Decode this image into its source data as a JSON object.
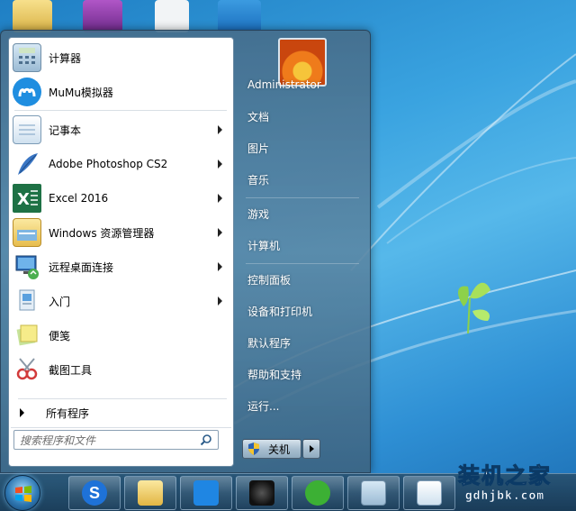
{
  "start_menu": {
    "programs": [
      {
        "label": "计算器",
        "icon": "calculator-icon",
        "has_submenu": false
      },
      {
        "label": "MuMu模拟器",
        "icon": "mumu-emulator-icon",
        "has_submenu": false
      },
      {
        "label": "记事本",
        "icon": "notepad-icon",
        "has_submenu": true
      },
      {
        "label": "Adobe Photoshop CS2",
        "icon": "photoshop-feather-icon",
        "has_submenu": true
      },
      {
        "label": "Excel 2016",
        "icon": "excel-icon",
        "has_submenu": true
      },
      {
        "label": "Windows 资源管理器",
        "icon": "explorer-folder-icon",
        "has_submenu": true
      },
      {
        "label": "远程桌面连接",
        "icon": "remote-desktop-icon",
        "has_submenu": true
      },
      {
        "label": "入门",
        "icon": "getting-started-icon",
        "has_submenu": true
      },
      {
        "label": "便笺",
        "icon": "sticky-notes-icon",
        "has_submenu": false
      },
      {
        "label": "截图工具",
        "icon": "snipping-tool-icon",
        "has_submenu": false
      }
    ],
    "all_programs_label": "所有程序",
    "search_placeholder": "搜索程序和文件",
    "right_items": [
      {
        "label": "Administrator"
      },
      {
        "label": "文档"
      },
      {
        "label": "图片"
      },
      {
        "label": "音乐"
      },
      {
        "label": "游戏"
      },
      {
        "label": "计算机"
      },
      {
        "label": "控制面板"
      },
      {
        "label": "设备和打印机"
      },
      {
        "label": "默认程序"
      },
      {
        "label": "帮助和支持"
      },
      {
        "label": "运行..."
      }
    ],
    "shutdown_label": "关机"
  },
  "taskbar": {
    "buttons": [
      {
        "icon": "sogou-browser-icon"
      },
      {
        "icon": "file-explorer-icon"
      },
      {
        "icon": "app-store-icon"
      },
      {
        "icon": "media-player-icon"
      },
      {
        "icon": "wechat-icon"
      },
      {
        "icon": "calculator-icon"
      },
      {
        "icon": "notepad-icon"
      }
    ]
  },
  "watermark": {
    "title": "装机之家",
    "url": "gdhjbk.com"
  },
  "colors": {
    "excel_green": "#1e7145",
    "mumu_blue": "#1f8ee0",
    "wechat_green": "#3cb034"
  }
}
